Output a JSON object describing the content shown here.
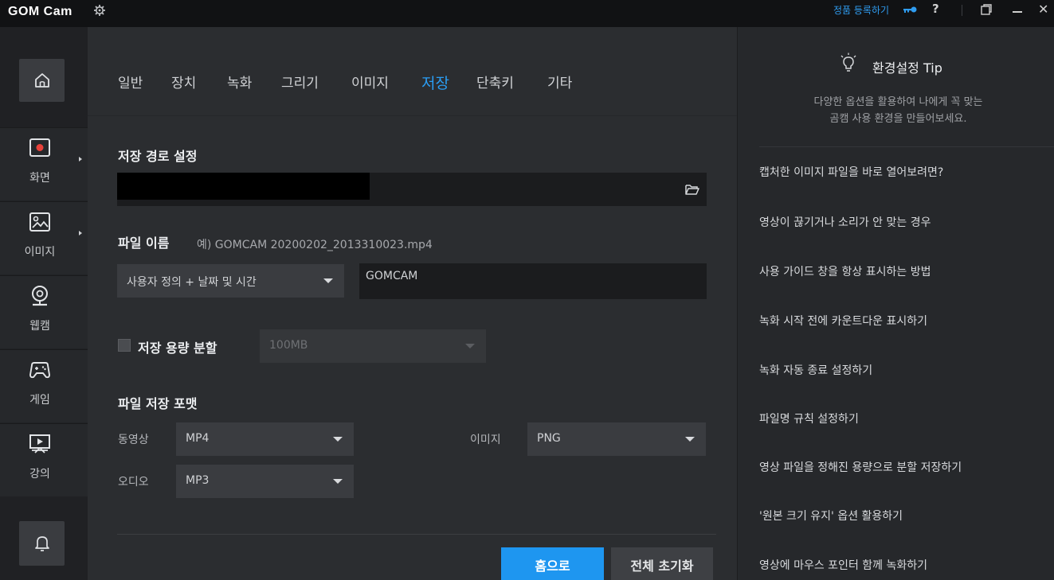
{
  "titlebar": {
    "app_name": "GOM Cam",
    "register_link": "정품 등록하기",
    "help_label": "?",
    "close_label": "✕"
  },
  "sidebar": {
    "items": [
      {
        "label": "화면",
        "icon": "screen-record-icon"
      },
      {
        "label": "이미지",
        "icon": "image-icon"
      },
      {
        "label": "웹캠",
        "icon": "webcam-icon"
      },
      {
        "label": "게임",
        "icon": "gamepad-icon"
      },
      {
        "label": "강의",
        "icon": "lecture-icon"
      }
    ]
  },
  "tabs": [
    {
      "label": "일반",
      "active": false
    },
    {
      "label": "장치",
      "active": false
    },
    {
      "label": "녹화",
      "active": false
    },
    {
      "label": "그리기",
      "active": false
    },
    {
      "label": "이미지",
      "active": false
    },
    {
      "label": "저장",
      "active": true
    },
    {
      "label": "단축키",
      "active": false
    },
    {
      "label": "기타",
      "active": false
    }
  ],
  "save": {
    "path_title": "저장 경로 설정",
    "file_name_title": "파일 이름",
    "file_name_example": "예) GOMCAM 20200202_2013310023.mp4",
    "name_mode": "사용자 정의 + 날짜 및 시간",
    "name_value": "GOMCAM",
    "split_label": "저장 용량 분할",
    "split_value": "100MB",
    "format_title": "파일 저장 포맷",
    "video_label": "동영상",
    "video_value": "MP4",
    "image_label": "이미지",
    "image_value": "PNG",
    "audio_label": "오디오",
    "audio_value": "MP3",
    "home_button": "홈으로",
    "reset_button": "전체 초기화"
  },
  "tips": {
    "title": "환경설정 Tip",
    "desc_line1": "다양한 옵션을 활용하여 나에게 꼭 맞는",
    "desc_line2": "곰캠 사용 환경을 만들어보세요.",
    "items": [
      "캡처한 이미지 파일을 바로 열어보려면?",
      "영상이 끊기거나 소리가 안 맞는 경우",
      "사용 가이드 창을 항상 표시하는 방법",
      "녹화 시작 전에 카운트다운 표시하기",
      "녹화 자동 종료 설정하기",
      "파일명 규칙 설정하기",
      "영상 파일을 정해진 용량으로 분할 저장하기",
      "'원본 크기 유지' 옵션 활용하기",
      "영상에 마우스 포인터 함께 녹화하기"
    ]
  },
  "colors": {
    "accent": "#1e96f0",
    "active_tab": "#2a9df4",
    "record_red": "#e8413a"
  }
}
